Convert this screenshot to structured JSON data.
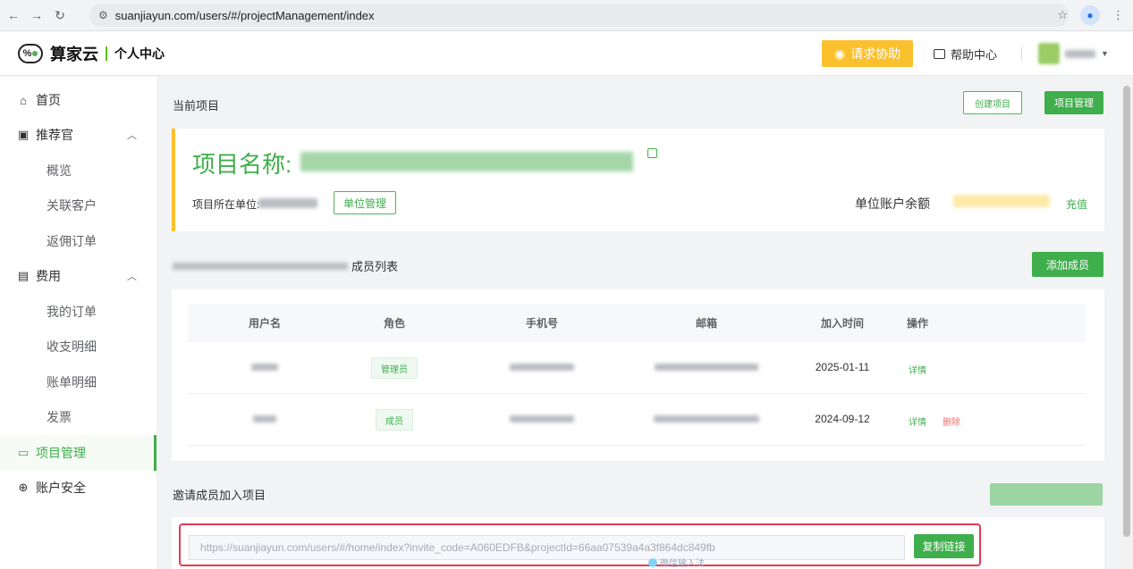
{
  "browser": {
    "url": "suanjiayun.com/users/#/projectManagement/index"
  },
  "header": {
    "brand": "算家云",
    "section": "个人中心",
    "help_button": "请求协助",
    "help_center": "帮助中心"
  },
  "sidebar": {
    "items": [
      {
        "label": "首页",
        "icon": "home-icon"
      },
      {
        "label": "推荐官",
        "icon": "recommend-icon",
        "expanded": true
      },
      {
        "label": "概览"
      },
      {
        "label": "关联客户"
      },
      {
        "label": "返佣订单"
      },
      {
        "label": "费用",
        "icon": "wallet-icon",
        "expanded": true
      },
      {
        "label": "我的订单"
      },
      {
        "label": "收支明细"
      },
      {
        "label": "账单明细"
      },
      {
        "label": "发票"
      },
      {
        "label": "项目管理",
        "icon": "project-icon",
        "active": true
      },
      {
        "label": "账户安全",
        "icon": "shield-icon"
      }
    ]
  },
  "main": {
    "current_project_title": "当前项目",
    "create_project": "创建项目",
    "project_management": "项目管理",
    "project_name_label": "项目名称:",
    "unit_label": "项目所在单位:",
    "unit_manage": "单位管理",
    "balance_label": "单位账户余额",
    "recharge": "充值",
    "members_list_title": "成员列表",
    "add_member": "添加成员",
    "table": {
      "columns": [
        "用户名",
        "角色",
        "手机号",
        "邮箱",
        "加入时间",
        "操作"
      ],
      "rows": [
        {
          "role": "管理员",
          "join_date": "2025-01-11",
          "actions": [
            "详情"
          ]
        },
        {
          "role": "成员",
          "join_date": "2024-09-12",
          "actions": [
            "详情",
            "删除"
          ]
        }
      ]
    },
    "invite_title": "邀请成员加入项目",
    "invite_link": "https://suanjiayun.com/users/#/home/index?invite_code=A060EDFB&projectId=66aa07539a4a3f864dc849fb",
    "copy_link": "复制链接",
    "ime_hint": "微信输入法"
  },
  "colors": {
    "accent_green": "#3fae4c",
    "help_yellow": "#fbc02d",
    "highlight_red": "#e53950",
    "delete_red": "#f56c6c"
  }
}
